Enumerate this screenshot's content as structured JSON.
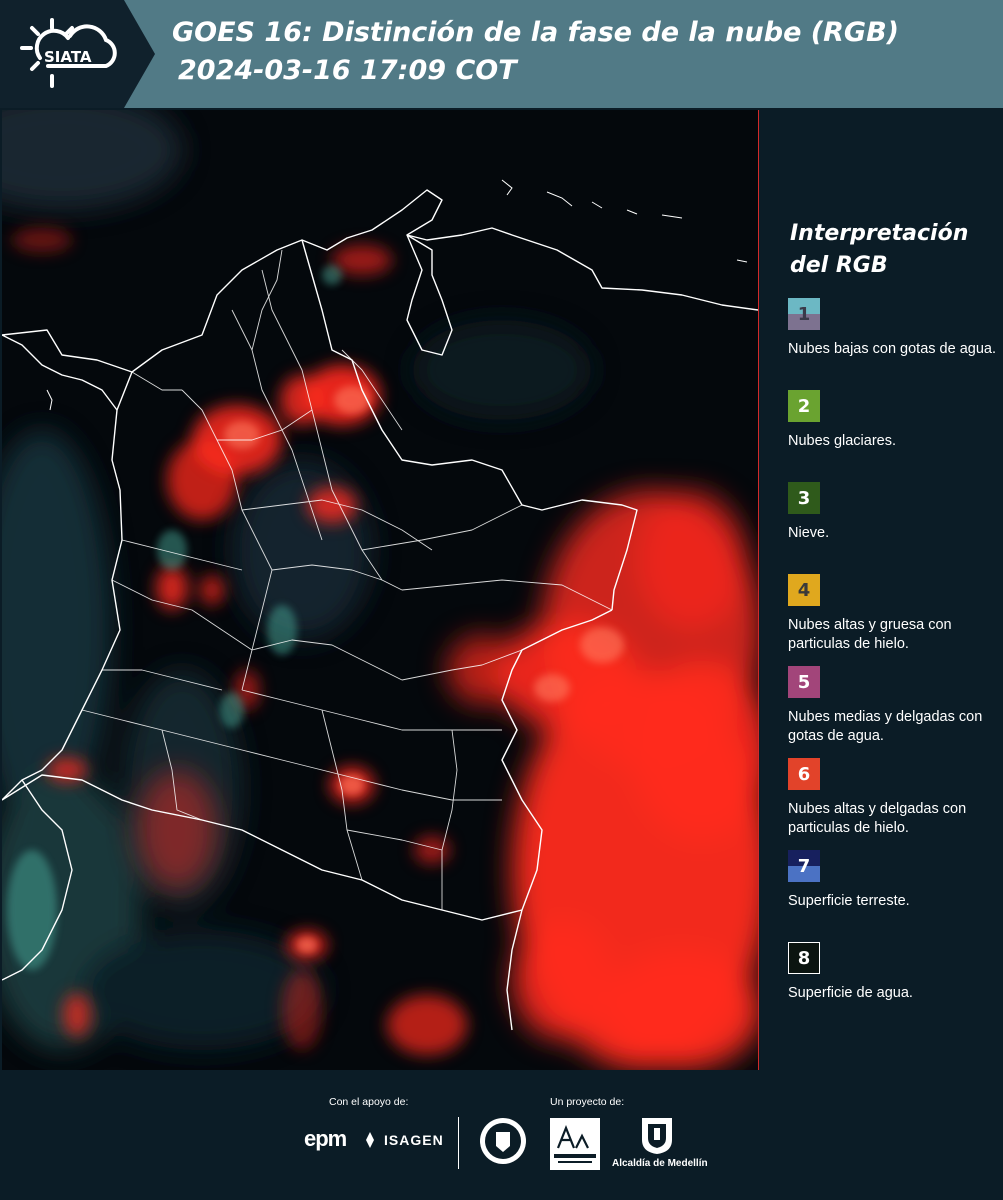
{
  "header": {
    "logo_text": "SIATA",
    "title_line1": "GOES 16: Distinción de la fase de la nube (RGB)",
    "title_line2": "2024-03-16 17:09 COT"
  },
  "legend": {
    "title_line1": "Interpretación",
    "title_line2": "del RGB",
    "items": [
      {
        "num": "1",
        "label": "Nubes bajas con gotas de agua.",
        "color_top": "#6cb8c4",
        "color_bottom": "#7d7290",
        "num_color": "#3a3a4a"
      },
      {
        "num": "2",
        "label": "Nubes glaciares.",
        "color_top": "#6aa330",
        "color_bottom": "#6aa330",
        "num_color": "#ffffff"
      },
      {
        "num": "3",
        "label": "Nieve.",
        "color_top": "#2f5a1b",
        "color_bottom": "#2f5a1b",
        "num_color": "#ffffff"
      },
      {
        "num": "4",
        "label": "Nubes altas y gruesa con particulas de hielo.",
        "color_top": "#e0a81e",
        "color_bottom": "#e0a81e",
        "num_color": "#3a3a3a"
      },
      {
        "num": "5",
        "label": "Nubes medias y delgadas con gotas de agua.",
        "color_top": "#a2457a",
        "color_bottom": "#a2457a",
        "num_color": "#ffffff"
      },
      {
        "num": "6",
        "label": "Nubes altas y delgadas con particulas de hielo.",
        "color_top": "#e2432a",
        "color_bottom": "#e2432a",
        "num_color": "#ffffff"
      },
      {
        "num": "7",
        "label": "Superficie terreste.",
        "color_top": "#17205e",
        "color_bottom": "#4b72c4",
        "num_color": "#ffffff"
      },
      {
        "num": "8",
        "label": "Superficie de agua.",
        "color_top": "#0b1410",
        "color_bottom": "#0b1410",
        "num_color": "#ffffff"
      }
    ]
  },
  "footer": {
    "support_caption": "Con el apoyo de:",
    "project_caption": "Un proyecto de:",
    "epm": "epm",
    "isagen": "ISAGEN",
    "alcaldia": "Alcaldía de Medellín"
  },
  "colors": {
    "header_bg": "#517a86",
    "page_bg": "#0b1c26",
    "cloud_red": "#ff2a1e",
    "boundary": "#ffffff"
  }
}
